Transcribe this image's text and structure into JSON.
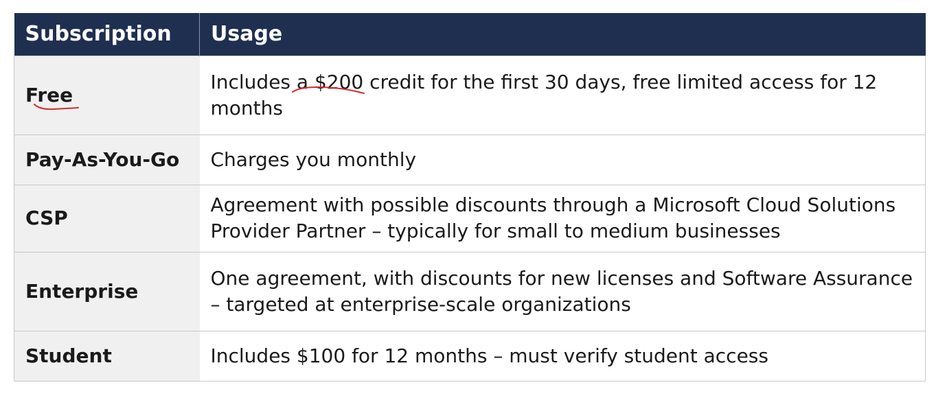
{
  "table": {
    "headers": {
      "subscription": "Subscription",
      "usage": "Usage"
    },
    "rows": [
      {
        "subscription": "Free",
        "usage": "Includes a $200 credit for the first 30 days, free limited access for 12 months"
      },
      {
        "subscription": "Pay-As-You-Go",
        "usage": "Charges you monthly"
      },
      {
        "subscription": "CSP",
        "usage": "Agreement with possible discounts through a Microsoft Cloud Solutions Provider Partner – typically for small to medium businesses"
      },
      {
        "subscription": "Enterprise",
        "usage": "One agreement, with discounts for new licenses and Software Assurance – targeted at enterprise-scale organizations"
      },
      {
        "subscription": "Student",
        "usage": "Includes $100 for 12 months – must verify student access"
      }
    ]
  },
  "colors": {
    "header_bg": "#1f2f50",
    "header_text": "#ffffff",
    "subscription_cell_bg": "#f0f0f0",
    "annotation_ink": "#d42a2a"
  }
}
